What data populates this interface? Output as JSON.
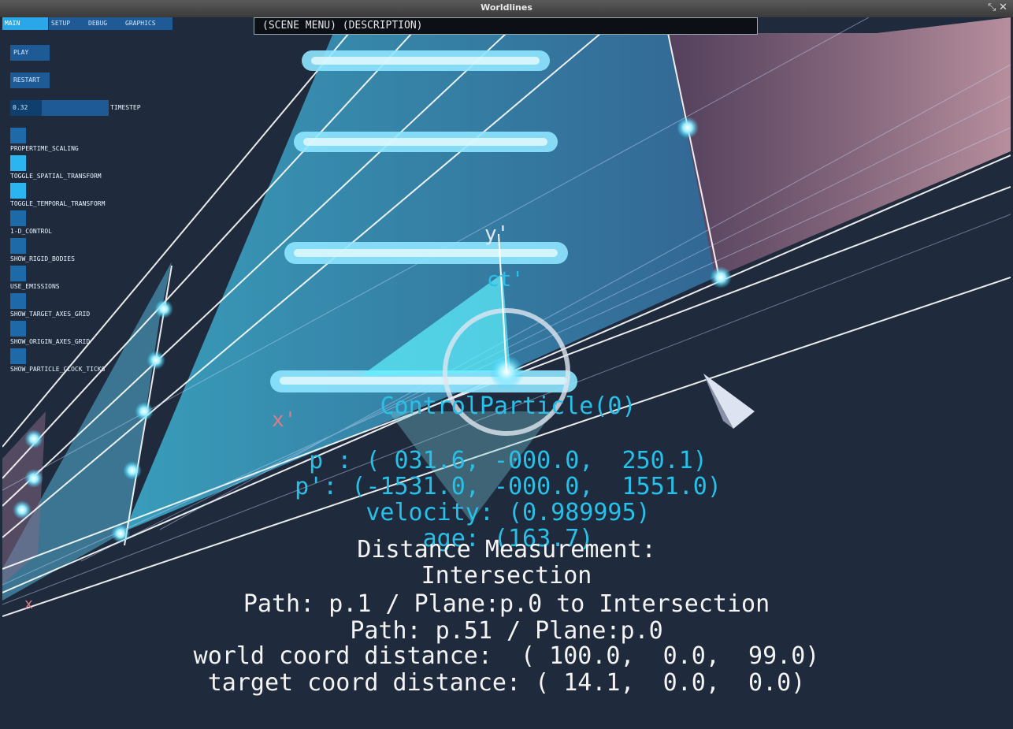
{
  "window": {
    "title": "Worldlines",
    "controls": [
      "⤡",
      "✕"
    ]
  },
  "tabs": [
    "MAIN",
    "SETUP",
    "DEBUG",
    "GRAPHICS"
  ],
  "buttons": {
    "play": "PLAY",
    "restart": "RESTART"
  },
  "timestep": {
    "value": "0.32",
    "label": "TIMESTEP",
    "fraction": 0.32
  },
  "toggles": [
    {
      "label": "PROPERTIME_SCALING",
      "on": false
    },
    {
      "label": "TOGGLE_SPATIAL_TRANSFORM",
      "on": true
    },
    {
      "label": "TOGGLE_TEMPORAL_TRANSFORM",
      "on": true
    },
    {
      "label": "1-D_CONTROL",
      "on": false
    },
    {
      "label": "SHOW_RIGID_BODIES",
      "on": false
    },
    {
      "label": "USE_EMISSIONS",
      "on": false
    },
    {
      "label": "SHOW_TARGET_AXES_GRID",
      "on": false
    },
    {
      "label": "SHOW_ORIGIN_AXES_GRID",
      "on": false
    },
    {
      "label": "SHOW_PARTICLE_CLOCK_TICKS",
      "on": false
    }
  ],
  "scene_menu": "(SCENE MENU) (DESCRIPTION)",
  "axes": {
    "y": "y'",
    "ct": "ct'",
    "xprime": "x'",
    "x": "x"
  },
  "particle": {
    "name": "ControlParticle(0)",
    "p": "p : ( 031.6, -000.0,  250.1)",
    "pprime": "p': (-1531.0, -000.0,  1551.0)",
    "velocity": "velocity: (0.989995)",
    "age": "age: (163.7)"
  },
  "measurement": {
    "heading": "Distance Measurement:",
    "type": "Intersection",
    "path1": "Path: p.1 / Plane:p.0 to Intersection",
    "path2": "Path: p.51 / Plane:p.0",
    "world": "world coord distance:  ( 100.0,  0.0,  99.0)",
    "target": "target coord distance: ( 14.1,  0.0,  0.0)"
  },
  "colors": {
    "accent": "#2ab4f0",
    "button": "#1e5a96",
    "background": "#1f2a3c",
    "info_cyan": "#27c0e8",
    "axis_pink": "#e07a86"
  }
}
